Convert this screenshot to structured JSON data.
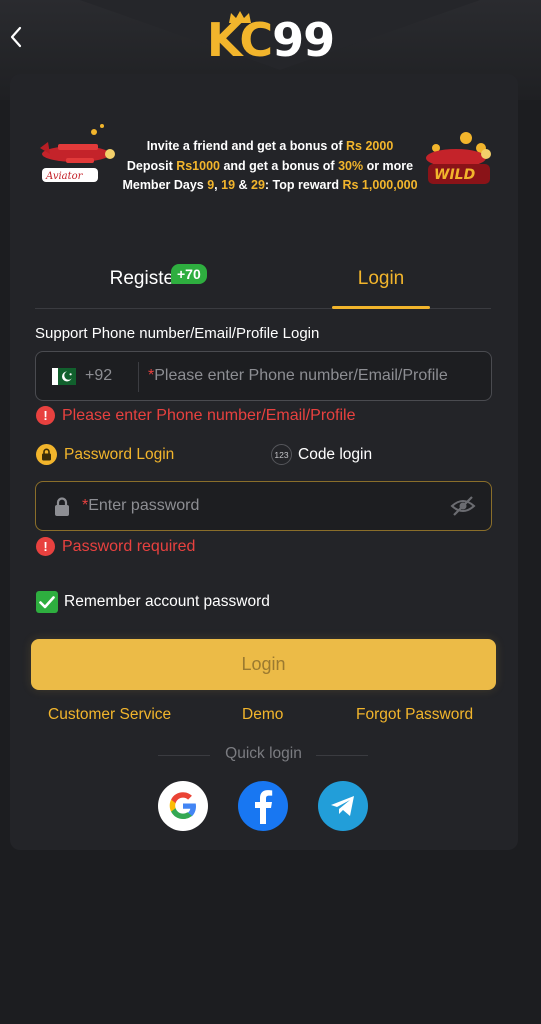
{
  "header": {
    "logo_kc": "KC",
    "logo_num": "99"
  },
  "promo": {
    "line1_text": "Invite a friend and get a bonus of ",
    "line1_hl": "Rs 2000",
    "line2_a": "Deposit ",
    "line2_hl1": "Rs1000",
    "line2_b": " and get a bonus of ",
    "line2_hl2": "30%",
    "line2_c": " or more",
    "line3_a": "Member Days ",
    "line3_d1": "9",
    "line3_sep1": ", ",
    "line3_d2": "19",
    "line3_sep2": " & ",
    "line3_d3": "29",
    "line3_b": ": Top reward ",
    "line3_hl": "Rs 1,000,000",
    "left_badge": "Aviator",
    "right_badge": "WILD"
  },
  "tabs": {
    "register": "Register",
    "register_badge": "+70",
    "login": "Login",
    "active": "Login"
  },
  "form": {
    "support_label": "Support Phone number/Email/Profile Login",
    "country_code": "+92",
    "phone_required_mark": "*",
    "phone_placeholder": "Please enter Phone number/Email/Profile",
    "phone_error": "Please enter Phone number/Email/Profile",
    "mode_password": "Password Login",
    "mode_code": "Code login",
    "mode_code_icon_text": "123",
    "password_required_mark": "*",
    "password_placeholder": "Enter password",
    "password_error": "Password required",
    "error_icon_text": "!",
    "remember_label": "Remember account password",
    "remember_checked": true,
    "login_button": "Login"
  },
  "links": {
    "customer_service": "Customer Service",
    "demo": "Demo",
    "forgot_password": "Forgot Password"
  },
  "quick_login": {
    "label": "Quick login",
    "google_letter": "G",
    "facebook_letter": "f"
  },
  "colors": {
    "accent": "#f2b52c",
    "error": "#e8413f",
    "success": "#2eae3f",
    "background": "#1c1d20",
    "card": "#232428"
  }
}
